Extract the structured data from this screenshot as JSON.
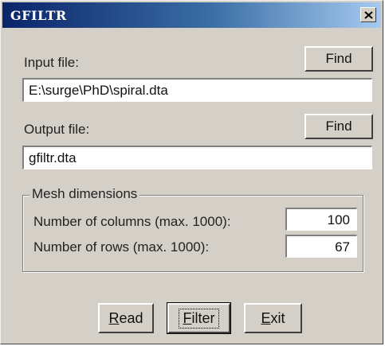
{
  "window": {
    "title": "GFILTR",
    "close_icon": "close-icon"
  },
  "input": {
    "label": "Input file:",
    "find_label": "Find",
    "value": "E:\\surge\\PhD\\spiral.dta"
  },
  "output": {
    "label": "Output file:",
    "find_label": "Find",
    "value": "gfiltr.dta"
  },
  "mesh": {
    "title": "Mesh dimensions",
    "columns_label": "Number of columns (max. 1000):",
    "columns_value": "100",
    "rows_label": "Number of rows (max. 1000):",
    "rows_value": "67"
  },
  "buttons": {
    "read": {
      "accel": "R",
      "rest": "ead"
    },
    "filter": {
      "accel": "F",
      "rest": "ilter"
    },
    "exit": {
      "accel": "E",
      "rest": "xit"
    }
  }
}
